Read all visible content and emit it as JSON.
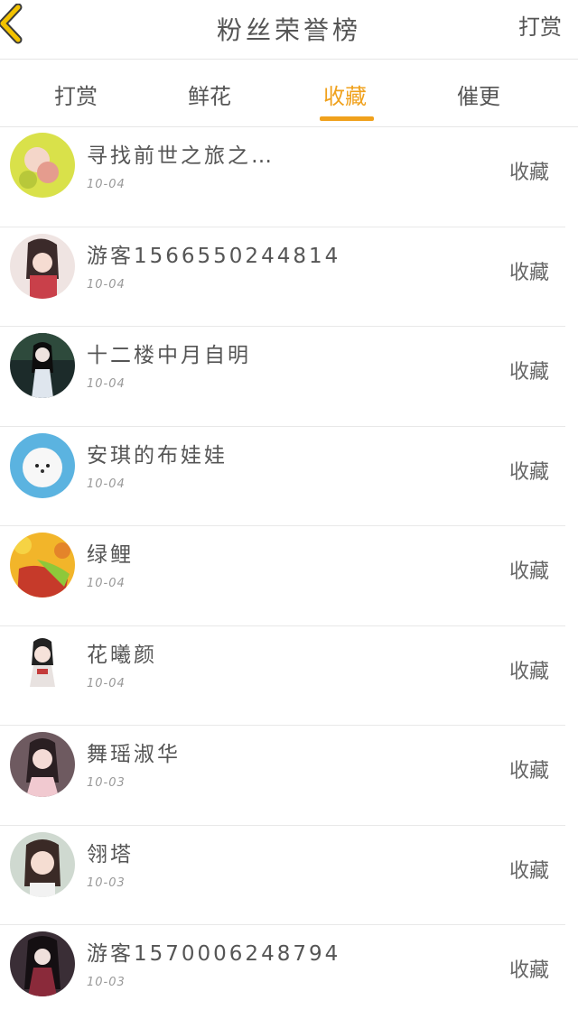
{
  "header": {
    "title": "粉丝荣誉榜",
    "right_label": "打赏"
  },
  "tabs": [
    {
      "label": "打赏",
      "active": false
    },
    {
      "label": "鲜花",
      "active": false
    },
    {
      "label": "收藏",
      "active": true
    },
    {
      "label": "催更",
      "active": false
    }
  ],
  "colors": {
    "accent": "#f0a11c",
    "back_arrow": "#f2c200"
  },
  "list": [
    {
      "name": "寻找前世之旅之…",
      "date": "10-04",
      "action": "收藏"
    },
    {
      "name": "游客1566550244814",
      "date": "10-04",
      "action": "收藏"
    },
    {
      "name": "十二楼中月自明",
      "date": "10-04",
      "action": "收藏"
    },
    {
      "name": "安琪的布娃娃",
      "date": "10-04",
      "action": "收藏"
    },
    {
      "name": "绿鲤",
      "date": "10-04",
      "action": "收藏"
    },
    {
      "name": "花曦颜",
      "date": "10-04",
      "action": "收藏"
    },
    {
      "name": "舞瑶淑华",
      "date": "10-03",
      "action": "收藏"
    },
    {
      "name": "翎塔",
      "date": "10-03",
      "action": "收藏"
    },
    {
      "name": "游客1570006248794",
      "date": "10-03",
      "action": "收藏"
    }
  ]
}
